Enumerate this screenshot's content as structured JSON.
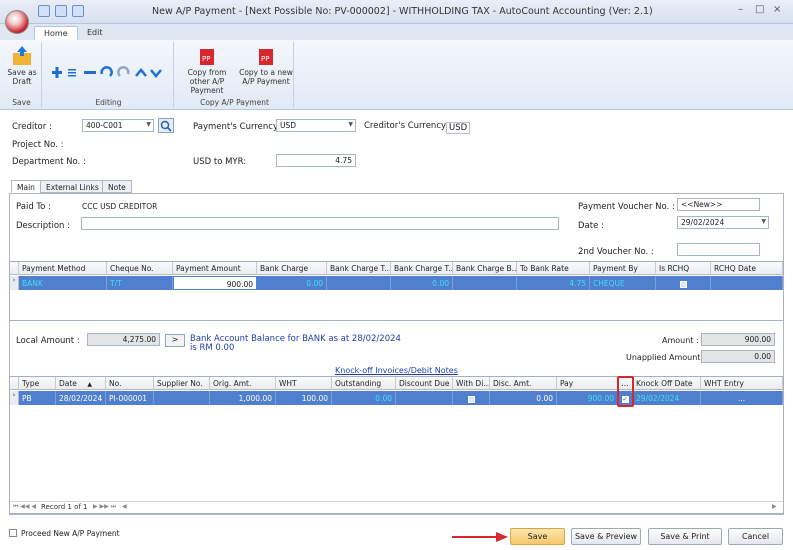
{
  "window": {
    "title": "New A/P Payment - [Next Possible No: PV-000002] - WITHHOLDING TAX - AutoCount Accounting (Ver: 2.1)",
    "min": "–",
    "max": "□",
    "close": "×"
  },
  "ribbon_tabs": [
    "Home",
    "Edit"
  ],
  "ribbon": {
    "save_draft": "Save as Draft",
    "save_group": "Save",
    "editing_group": "Editing",
    "copy_from": "Copy from other A/P Payment",
    "copy_to": "Copy to a new A/P Payment",
    "copy_group": "Copy A/P Payment"
  },
  "header": {
    "creditor_label": "Creditor :",
    "creditor_value": "400-C001",
    "currency_label": "Payment's Currency :",
    "currency_value": "USD",
    "creditor_currency_label": "Creditor's Currency :",
    "creditor_currency_value": "USD",
    "project_label": "Project No. :",
    "department_label": "Department No. :",
    "rate_label": "USD to MYR:",
    "rate_value": "4.75"
  },
  "page_tabs": [
    "Main",
    "External Links",
    "Note"
  ],
  "main": {
    "paid_to_label": "Paid To :",
    "paid_to_value": "CCC USD CREDITOR",
    "description_label": "Description :",
    "pv_no_label": "Payment Voucher No. :",
    "pv_no_value": "<<New>>",
    "date_label": "Date :",
    "date_value": "29/02/2024",
    "voucher2_label": "2nd Voucher No. :"
  },
  "payment_grid": {
    "columns": [
      "Payment Method",
      "Cheque No.",
      "Payment Amount",
      "Bank Charge",
      "Bank Charge T...",
      "Bank Charge T...",
      "Bank Charge B...",
      "To Bank Rate",
      "Payment By",
      "Is RCHQ",
      "RCHQ Date"
    ],
    "row": [
      "BANK",
      "T/T",
      "900.00",
      "0.00",
      "",
      "0.00",
      "",
      "4.75",
      "CHEQUE",
      "",
      ""
    ]
  },
  "amounts": {
    "local_label": "Local Amount :",
    "local_value": "4,275.00",
    "arrow": ">",
    "balance_text": "Bank Account Balance for BANK as at 28/02/2024 is RM 0.00",
    "amount_label": "Amount :",
    "amount_value": "900.00",
    "unapplied_label": "Unapplied Amount :",
    "unapplied_value": "0.00"
  },
  "knockoff": {
    "title": "Knock-off Invoices/Debit Notes",
    "columns": [
      "Type",
      "Date",
      "No.",
      "Supplier No.",
      "Orig. Amt.",
      "WHT",
      "Outstanding",
      "Discount Due",
      "With Di...",
      "Disc. Amt.",
      "Pay",
      "...",
      "Knock Off Date",
      "WHT Entry"
    ],
    "row": [
      "PB",
      "28/02/2024",
      "PI-000001",
      "",
      "1,000.00",
      "100.00",
      "0.00",
      "",
      "",
      "0.00",
      "900.00",
      "",
      "29/02/2024",
      "..."
    ],
    "record_text": "Record 1 of 1"
  },
  "footer": {
    "proceed_label": "Proceed New A/P Payment",
    "save": "Save",
    "save_preview": "Save & Preview",
    "save_print": "Save & Print",
    "cancel": "Cancel"
  },
  "colors": {
    "selected_row": "#4f7fce",
    "accent_red": "#d9272e",
    "save_highlight": "#f7c76a"
  }
}
